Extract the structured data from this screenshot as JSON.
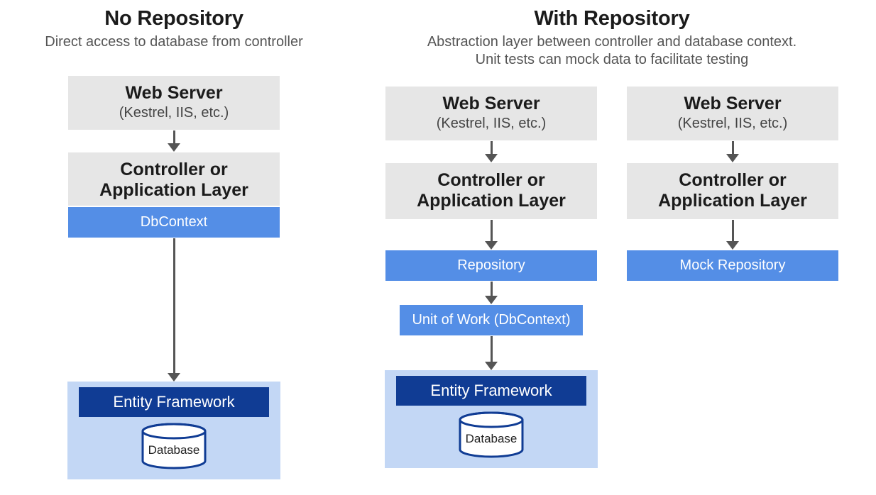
{
  "left": {
    "title": "No Repository",
    "subtitle": "Direct access to database from controller",
    "col": {
      "webserver_title": "Web Server",
      "webserver_sub": "(Kestrel, IIS, etc.)",
      "controller_l1": "Controller or",
      "controller_l2": "Application Layer",
      "dbcontext": "DbContext",
      "ef": "Entity Framework",
      "db": "Database"
    }
  },
  "right": {
    "title": "With Repository",
    "subtitle_l1": "Abstraction layer between controller and database context.",
    "subtitle_l2": "Unit tests can mock data to facilitate testing",
    "col1": {
      "webserver_title": "Web Server",
      "webserver_sub": "(Kestrel, IIS, etc.)",
      "controller_l1": "Controller or",
      "controller_l2": "Application Layer",
      "repository": "Repository",
      "uow": "Unit of Work (DbContext)",
      "ef": "Entity Framework",
      "db": "Database"
    },
    "col2": {
      "webserver_title": "Web Server",
      "webserver_sub": "(Kestrel, IIS, etc.)",
      "controller_l1": "Controller or",
      "controller_l2": "Application Layer",
      "mockrepo": "Mock Repository"
    }
  }
}
